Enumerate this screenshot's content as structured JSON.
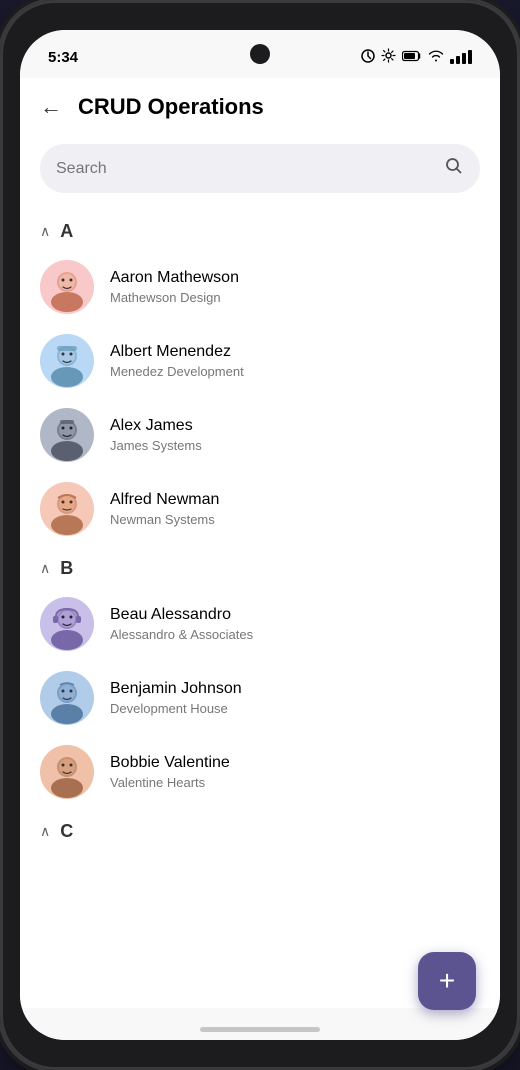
{
  "statusBar": {
    "time": "5:34",
    "icons": [
      "data-saver",
      "settings",
      "battery"
    ]
  },
  "header": {
    "backLabel": "←",
    "title": "CRUD Operations"
  },
  "search": {
    "placeholder": "Search"
  },
  "sections": [
    {
      "letter": "A",
      "contacts": [
        {
          "name": "Aaron Mathewson",
          "company": "Mathewson Design",
          "avatarBg": "av-pink"
        },
        {
          "name": "Albert Menendez",
          "company": "Menedez Development",
          "avatarBg": "av-blue"
        },
        {
          "name": "Alex James",
          "company": "James Systems",
          "avatarBg": "av-dark"
        },
        {
          "name": "Alfred Newman",
          "company": "Newman Systems",
          "avatarBg": "av-peach"
        }
      ]
    },
    {
      "letter": "B",
      "contacts": [
        {
          "name": "Beau Alessandro",
          "company": "Alessandro & Associates",
          "avatarBg": "av-lavender"
        },
        {
          "name": "Benjamin Johnson",
          "company": "Development House",
          "avatarBg": "av-lightblue"
        },
        {
          "name": "Bobbie Valentine",
          "company": "Valentine Hearts",
          "avatarBg": "av-peach"
        }
      ]
    },
    {
      "letter": "C",
      "contacts": []
    }
  ],
  "fab": {
    "label": "+"
  }
}
